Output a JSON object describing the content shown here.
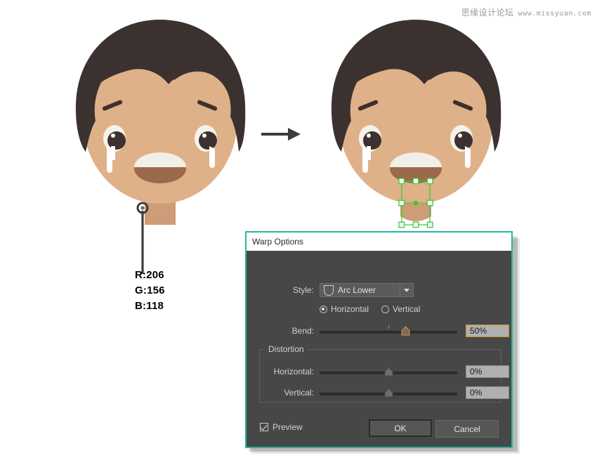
{
  "watermark": {
    "cn": "思缘设计论坛",
    "url": "www.missyuan.com"
  },
  "illustration": {
    "left_face_name": "crying-boy-face-original",
    "right_face_name": "crying-boy-face-warped",
    "arrow_name": "transform-arrow",
    "colors": {
      "hair": "#3b322f",
      "skin": "#dfb189",
      "skin_shadow": "#d2a178",
      "neck": "#ce9c76",
      "mouth": "#9a6a4a",
      "teeth": "#f2efe9",
      "eye_white": "#f5f2ec",
      "pupil": "#3b322f",
      "tear": "#ffffff",
      "selection": "#33cc33"
    },
    "color_callout": {
      "r": "R:206",
      "g": "G:156",
      "b": "B:118"
    }
  },
  "dialog": {
    "title": "Warp Options",
    "accent_border": "#25b79b",
    "body_bg": "#474747",
    "style": {
      "label": "Style:",
      "value": "Arc Lower",
      "icon": "arc-lower-icon",
      "caret": "chevron-down-icon"
    },
    "orientation": {
      "horizontal_label": "Horizontal",
      "vertical_label": "Vertical",
      "selected": "Horizontal"
    },
    "bend": {
      "label": "Bend:",
      "value": "50%",
      "slider_percent": 62,
      "tick_percent": 50,
      "min": -100,
      "max": 100
    },
    "distortion": {
      "legend": "Distortion",
      "horizontal": {
        "label": "Horizontal:",
        "value": "0%",
        "slider_percent": 50
      },
      "vertical": {
        "label": "Vertical:",
        "value": "0%",
        "slider_percent": 50
      }
    },
    "preview": {
      "label": "Preview",
      "checked": true
    },
    "buttons": {
      "ok": "OK",
      "cancel": "Cancel"
    }
  }
}
